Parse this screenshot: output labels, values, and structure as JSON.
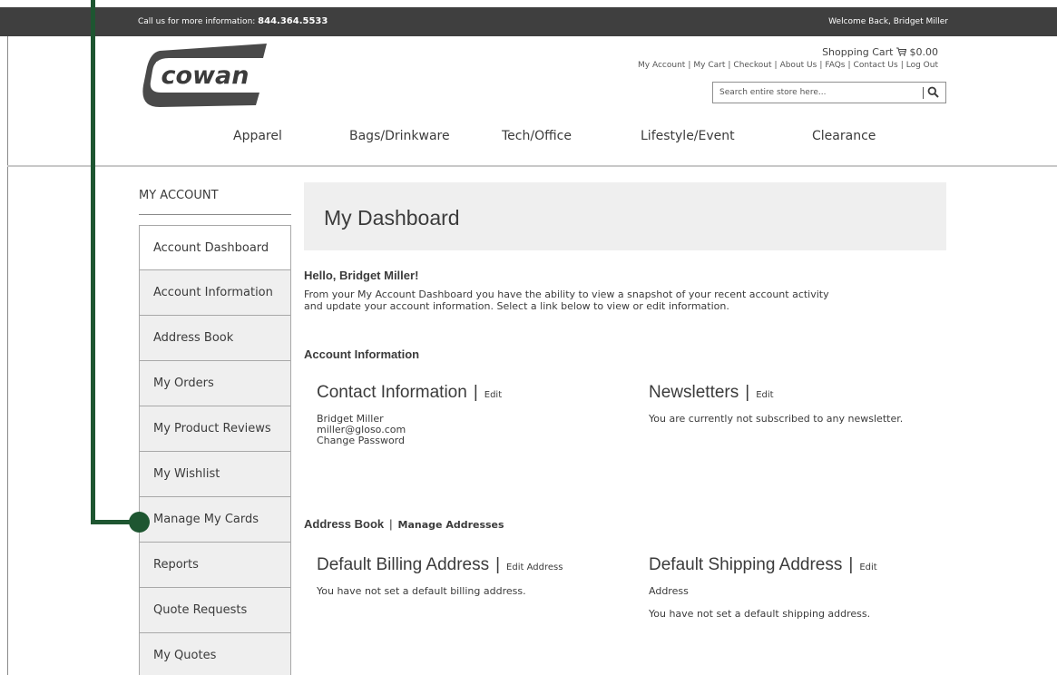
{
  "topbar": {
    "call_label": "Call us for more information: ",
    "phone": "844.364.5533",
    "welcome": "Welcome Back, Bridget Miller"
  },
  "logo": {
    "text": "cowan"
  },
  "header": {
    "cart_label": "Shopping Cart",
    "cart_total": "$0.00",
    "links": [
      "My Account",
      "My Cart",
      "Checkout",
      "About Us",
      "FAQs",
      "Contact Us",
      "Log Out"
    ]
  },
  "search": {
    "placeholder": "Search entire store here..."
  },
  "nav": [
    "Apparel",
    "Bags/Drinkware",
    "Tech/Office",
    "Lifestyle/Event",
    "Clearance"
  ],
  "sidebar": {
    "title": "MY ACCOUNT",
    "items": [
      "Account Dashboard",
      "Account Information",
      "Address Book",
      "My Orders",
      "My Product Reviews",
      "My Wishlist",
      "Manage My Cards",
      "Reports",
      "Quote Requests",
      "My Quotes"
    ]
  },
  "main": {
    "title": "My Dashboard",
    "hello": "Hello, Bridget Miller!",
    "intro": "From your My Account Dashboard you have the ability to view a snapshot of your recent account activity and update your account information. Select a link below to view or edit information.",
    "account_info_heading": "Account Information",
    "contact": {
      "heading": "Contact Information",
      "edit": "Edit",
      "name": "Bridget Miller",
      "email": "miller@gloso.com",
      "change_password": "Change Password"
    },
    "newsletters": {
      "heading": "Newsletters",
      "edit": "Edit",
      "text": "You are currently not subscribed to any newsletter."
    },
    "address_book": {
      "heading": "Address Book",
      "manage": "Manage Addresses"
    },
    "billing": {
      "heading": "Default Billing Address",
      "edit": "Edit Address",
      "text": "You have not set a default billing address."
    },
    "shipping": {
      "heading": "Default Shipping Address",
      "edit": "Edit",
      "edit_line2": "Address",
      "text": "You have not set a default shipping address."
    }
  },
  "colors": {
    "topbar": "#3f3f3f",
    "callout": "#1e5631",
    "panel": "#efefef"
  }
}
